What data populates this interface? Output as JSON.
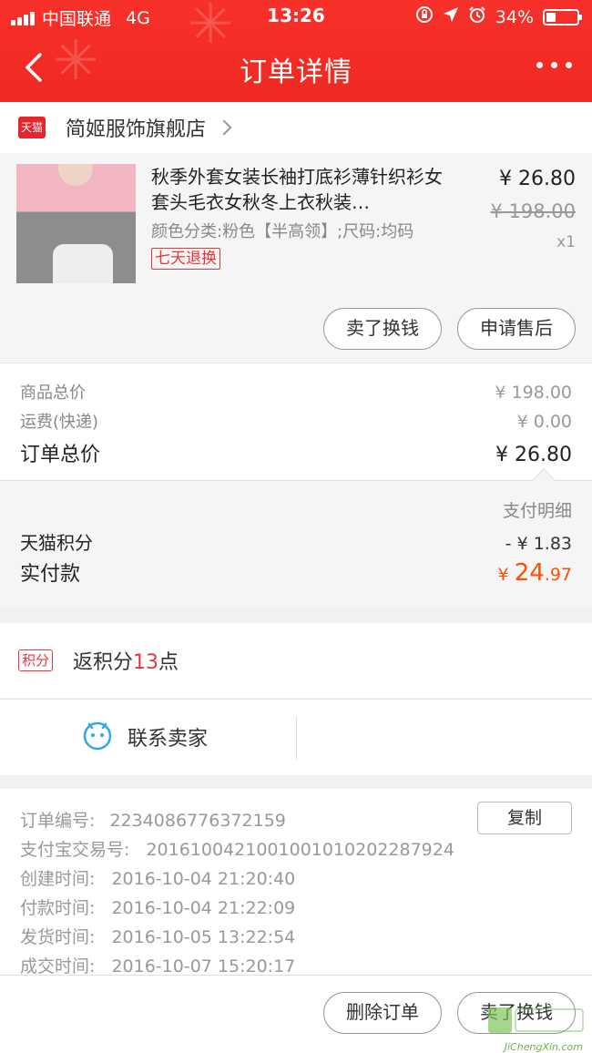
{
  "status_bar": {
    "carrier": "中国联通",
    "network": "4G",
    "time": "13:26",
    "battery": "34%"
  },
  "nav": {
    "title": "订单详情"
  },
  "store": {
    "badge": "天猫",
    "name": "简姬服饰旗舰店"
  },
  "product": {
    "title": "秋季外套女装长袖打底衫薄针织衫女套头毛衣女秋冬上衣秋装…",
    "spec": "颜色分类:粉色【半高领】;尺码:均码",
    "return_tag": "七天退换",
    "price": "¥ 26.80",
    "original_price": "¥ 198.00",
    "quantity": "x1",
    "sell_button": "卖了换钱",
    "aftersale_button": "申请售后"
  },
  "totals": {
    "goods_label": "商品总价",
    "goods_value": "¥ 198.00",
    "shipping_label": "运费(快递)",
    "shipping_value": "¥ 0.00",
    "order_total_label": "订单总价",
    "order_total_value": "¥ 26.80"
  },
  "payment": {
    "detail_link": "支付明细",
    "points_label": "天猫积分",
    "points_value": "- ¥ 1.83",
    "paid_label": "实付款",
    "paid_currency": "¥ ",
    "paid_int": "24",
    "paid_dec": ".97"
  },
  "rebate": {
    "badge": "积分",
    "text_prefix": "返积分",
    "points": "13",
    "text_suffix": "点"
  },
  "contact": {
    "label": "联系卖家"
  },
  "order_info": {
    "order_no_label": "订单编号:",
    "order_no": "2234086776372159",
    "copy_button": "复制",
    "alipay_label": "支付宝交易号:",
    "alipay_no": "2016100421001001010202287924",
    "created_label": "创建时间:",
    "created": "2016-10-04 21:20:40",
    "paid_label": "付款时间:",
    "paid": "2016-10-04 21:22:09",
    "shipped_label": "发货时间:",
    "shipped": "2016-10-05 13:22:54",
    "completed_label": "成交时间:",
    "completed": "2016-10-07 15:20:17"
  },
  "footer": {
    "delete_button": "删除订单",
    "sell_button": "卖了换钱"
  },
  "watermark": {
    "text": "JiChengXin.com"
  },
  "colors": {
    "header_red": "#ee2a22",
    "accent_orange": "#ff5000",
    "accent_red": "#e4393c"
  }
}
